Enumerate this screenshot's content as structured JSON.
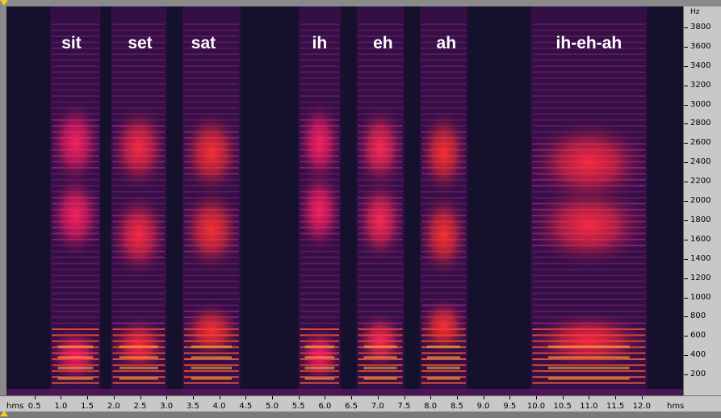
{
  "words": [
    {
      "text": "sit",
      "t": 1.2
    },
    {
      "text": "set",
      "t": 2.5
    },
    {
      "text": "sat",
      "t": 3.7
    },
    {
      "text": "ih",
      "t": 5.9
    },
    {
      "text": "eh",
      "t": 7.1
    },
    {
      "text": "ah",
      "t": 8.3
    },
    {
      "text": "ih-eh-ah",
      "t": 11.0
    }
  ],
  "y_axis": {
    "unit": "Hz",
    "ticks": [
      "200",
      "400",
      "600",
      "800",
      "1000",
      "1200",
      "1400",
      "1600",
      "1800",
      "2000",
      "2200",
      "2400",
      "2600",
      "2800",
      "3000",
      "3200",
      "3400",
      "3600",
      "3800"
    ]
  },
  "x_axis": {
    "unit_left": "hms",
    "unit_right": "hms",
    "ticks": [
      "0.5",
      "1.0",
      "1.5",
      "2.0",
      "2.5",
      "3.0",
      "3.5",
      "4.0",
      "4.5",
      "5.0",
      "5.5",
      "6.0",
      "6.5",
      "7.0",
      "7.5",
      "8.0",
      "8.5",
      "9.0",
      "9.5",
      "10.0",
      "10.5",
      "11.0",
      "11.5",
      "12.0"
    ]
  },
  "segments": [
    {
      "name": "sit",
      "t0": 0.8,
      "t1": 1.75,
      "formants": [
        400,
        1850,
        2600
      ],
      "color": "#ff2060"
    },
    {
      "name": "set",
      "t0": 1.95,
      "t1": 3.0,
      "formants": [
        500,
        1650,
        2550
      ],
      "color": "#ff2a40"
    },
    {
      "name": "sat",
      "t0": 3.3,
      "t1": 4.4,
      "formants": [
        650,
        1700,
        2500
      ],
      "color": "#ff3030"
    },
    {
      "name": "ih",
      "t0": 5.5,
      "t1": 6.3,
      "formants": [
        400,
        1900,
        2600
      ],
      "color": "#ff2060"
    },
    {
      "name": "eh",
      "t0": 6.6,
      "t1": 7.5,
      "formants": [
        550,
        1800,
        2550
      ],
      "color": "#ff2a50"
    },
    {
      "name": "ah",
      "t0": 7.8,
      "t1": 8.7,
      "formants": [
        700,
        1650,
        2500
      ],
      "color": "#ff3030"
    },
    {
      "name": "ih-eh-ah",
      "t0": 9.9,
      "t1": 12.1,
      "formants": [
        550,
        1750,
        2400
      ],
      "color": "#ff2a40"
    }
  ],
  "colors": {
    "background": "#15102c",
    "accent": "#f0d020"
  }
}
